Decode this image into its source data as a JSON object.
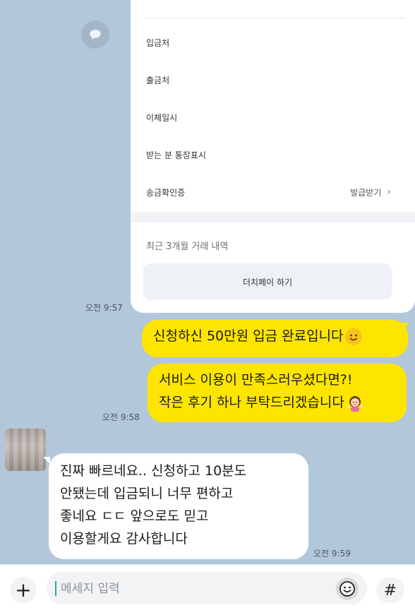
{
  "card": {
    "rows": [
      {
        "label": "입금처"
      },
      {
        "label": "출금처"
      },
      {
        "label": "이체일시"
      },
      {
        "label": "받는 분 통장표시"
      },
      {
        "label": "송금확인증",
        "action": "발급받기"
      }
    ],
    "recent_label": "최근 3개월 거래 내역",
    "pay_button": "더치페이 하기"
  },
  "messages": [
    {
      "time": "오전 9:57"
    },
    {
      "text": "신청하신 50만원 입금 완료입니다",
      "emoji": "slightly-smiling-face"
    },
    {
      "lines": [
        "서비스 이용이 만족스러우셨다면?!",
        "작은 후기 하나 부탁드리겠습니다"
      ],
      "emoji": "person-gesturing-ok",
      "time": "오전 9:58"
    },
    {
      "lines": [
        "진짜 빠르네요.. 신청하고 10분도",
        "안됐는데 입금되니 너무 편하고",
        "좋네요 ㄷㄷ 앞으로도 믿고",
        "이용할게요 감사합니다"
      ],
      "time": "오전 9:59"
    }
  ],
  "input": {
    "placeholder": "메세지 입력",
    "plus": "+",
    "hash": "#"
  },
  "colors": {
    "background": "#b2c7da",
    "my_bubble": "#fee500",
    "other_bubble": "#ffffff"
  }
}
